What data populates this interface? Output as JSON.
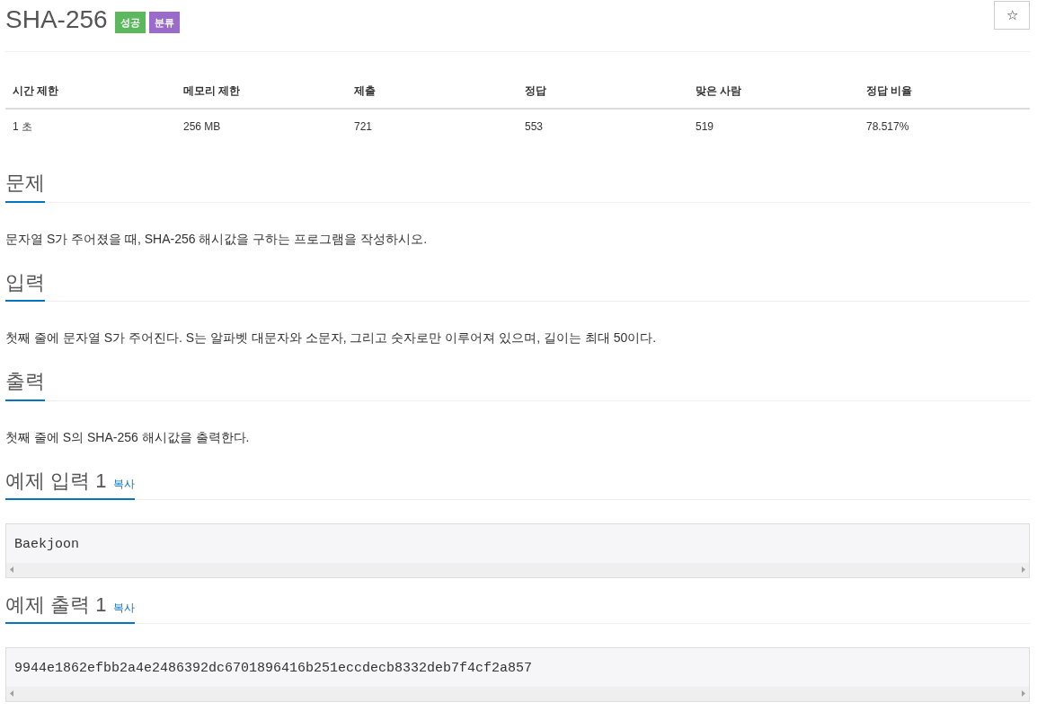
{
  "title": "SHA-256",
  "badges": [
    {
      "label": "성공",
      "color": "#5cb85c"
    },
    {
      "label": "분류",
      "color": "#9b6bcc"
    }
  ],
  "star_button": {
    "label": "☆"
  },
  "info_table": {
    "columns": [
      "시간 제한",
      "메모리 제한",
      "제출",
      "정답",
      "맞은 사람",
      "정답 비율"
    ],
    "rows": [
      [
        "1 초",
        "256 MB",
        "721",
        "553",
        "519",
        "78.517%"
      ]
    ]
  },
  "sections": [
    {
      "kind": "text",
      "heading": "문제",
      "body": "문자열 S가 주어졌을 때, SHA-256 해시값을 구하는 프로그램을 작성하시오."
    },
    {
      "kind": "text",
      "heading": "입력",
      "body": "첫째 줄에 문자열 S가 주어진다. S는 알파벳 대문자와 소문자, 그리고 숫자로만 이루어져 있으며, 길이는 최대 50이다."
    },
    {
      "kind": "text",
      "heading": "출력",
      "body": "첫째 줄에 S의 SHA-256 해시값을 출력한다."
    },
    {
      "kind": "sample",
      "heading": "예제 입력 1",
      "copy": "복사",
      "body": "Baekjoon"
    },
    {
      "kind": "sample",
      "heading": "예제 출력 1",
      "copy": "복사",
      "body": "9944e1862efbb2a4e2486392dc6701896416b251eccdecb8332deb7f4cf2a857"
    }
  ]
}
